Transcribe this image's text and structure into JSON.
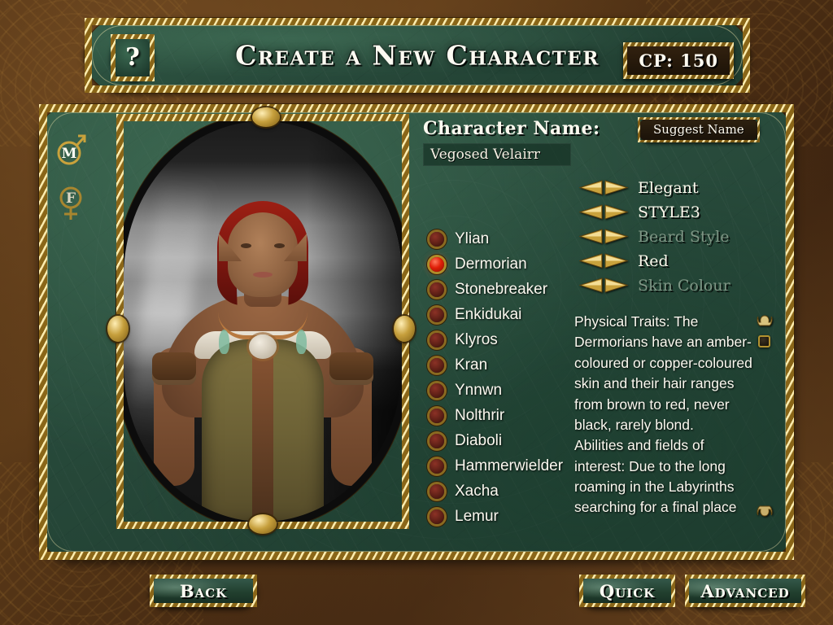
{
  "header": {
    "title": "Create a New Character",
    "help_icon_label": "?",
    "cp_badge": "CP: 150"
  },
  "gender": {
    "male_label": "M",
    "female_label": "F",
    "selected": "M"
  },
  "character_name": {
    "label": "Character Name:",
    "value": "Vegosed Velairr",
    "placeholder": "Character Name",
    "suggest_button": "Suggest Name"
  },
  "appearance": {
    "rows": [
      {
        "value": "Elegant",
        "enabled": true
      },
      {
        "value": "STYLE3",
        "enabled": true
      },
      {
        "value": "Beard Style",
        "enabled": false
      },
      {
        "value": "Red",
        "enabled": true
      },
      {
        "value": "Skin Colour",
        "enabled": false
      }
    ],
    "prev_icon": "left-arrow-icon",
    "next_icon": "right-arrow-icon"
  },
  "races": {
    "selected": "Dermorian",
    "items": [
      "Ylian",
      "Dermorian",
      "Stonebreaker",
      "Enkidukai",
      "Klyros",
      "Kran",
      "Ynnwn",
      "Nolthrir",
      "Diaboli",
      "Hammerwielder",
      "Xacha",
      "Lemur"
    ]
  },
  "description": {
    "text": "Physical Traits: The Dermorians have an amber-coloured or copper-coloured skin and their hair ranges from brown to red, never black, rarely blond.\nAbilities and fields of interest: Due to the long roaming in the Labyrinths searching for a final place"
  },
  "footer": {
    "back": "Back",
    "quick": "Quick",
    "advanced": "Advanced"
  },
  "colors": {
    "panel_green": "#27493a",
    "gold": "#b8922f",
    "leather_brown": "#4a2d12",
    "selected_gem": "#e01f08",
    "text_light": "#fbf8ef",
    "text_disabled": "#8ea392"
  }
}
